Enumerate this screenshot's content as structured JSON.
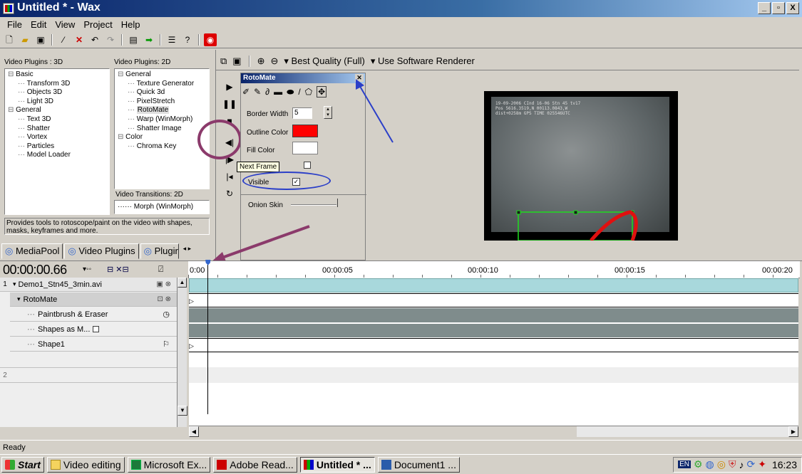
{
  "window": {
    "title": "Untitled * - Wax",
    "min": "_",
    "max": "▫",
    "close": "X"
  },
  "menu": [
    "File",
    "Edit",
    "View",
    "Project",
    "Help"
  ],
  "plugins": {
    "header_3d": "Video Plugins : 3D",
    "header_2d": "Video Plugins: 2D",
    "tree_3d": [
      {
        "label": "Basic",
        "indent": 0
      },
      {
        "label": "Transform 3D",
        "indent": 1
      },
      {
        "label": "Objects 3D",
        "indent": 1
      },
      {
        "label": "Light 3D",
        "indent": 1
      },
      {
        "label": "General",
        "indent": 0
      },
      {
        "label": "Text 3D",
        "indent": 1
      },
      {
        "label": "Shatter",
        "indent": 1
      },
      {
        "label": "Vortex",
        "indent": 1
      },
      {
        "label": "Particles",
        "indent": 1
      },
      {
        "label": "Model Loader",
        "indent": 1
      }
    ],
    "tree_2d": [
      {
        "label": "General",
        "indent": 0
      },
      {
        "label": "Texture Generator",
        "indent": 1
      },
      {
        "label": "Quick 3d",
        "indent": 1
      },
      {
        "label": "PixelStretch",
        "indent": 1
      },
      {
        "label": "RotoMate",
        "indent": 1,
        "selected": true
      },
      {
        "label": "Warp (WinMorph)",
        "indent": 1
      },
      {
        "label": "Shatter Image",
        "indent": 1
      },
      {
        "label": "Color",
        "indent": 0
      },
      {
        "label": "Chroma Key",
        "indent": 1
      }
    ],
    "transitions_header": "Video Transitions: 2D",
    "transition_item": "Morph (WinMorph)",
    "description": "Provides tools to rotoscope/paint on the video with shapes, masks, keyframes and more."
  },
  "tabs": [
    "MediaPool",
    "Video Plugins",
    "Plugir"
  ],
  "preview_toolbar": {
    "quality": "Best Quality (Full)",
    "renderer": "Use Software Renderer"
  },
  "rotomate": {
    "title": "RotoMate",
    "border_width_label": "Border Width",
    "border_width_value": "5",
    "outline_color_label": "Outline Color",
    "outline_color": "#ff0000",
    "fill_color_label": "Fill Color",
    "fill_color": "#ffffff",
    "tooltip": "Next Frame",
    "visible_label": "Visible",
    "onion_skin_label": "Onion Skin"
  },
  "video_overlay": [
    "19-09-2006 CInd 16-06 Stn 45 tv17",
    "Pos 5616.3519,N 00113.0843,W",
    "dist+0258m GPS TIME 025546UTC"
  ],
  "timeline": {
    "timecode": "00:00:00.66",
    "ticks": [
      "0:00",
      "00:00:05",
      "00:00:10",
      "00:00:15",
      "00:00:20"
    ],
    "tracks": [
      {
        "num": "1",
        "label": "Demo1_Stn45_3min.avi"
      },
      {
        "label": "RotoMate"
      },
      {
        "label": "Paintbrush & Eraser"
      },
      {
        "label": "Shapes as M..."
      },
      {
        "label": "Shape1"
      },
      {
        "num": "2",
        "label": ""
      }
    ]
  },
  "status": "Ready",
  "taskbar": {
    "start": "Start",
    "items": [
      "Video editing",
      "Microsoft Ex...",
      "Adobe Read...",
      "Untitled * ...",
      "Document1 ..."
    ],
    "lang": "EN",
    "clock": "16:23"
  },
  "colors": {
    "accent": "#0a246a",
    "track_teal": "#a8d8dc",
    "track_gray": "#7f8c8c"
  }
}
